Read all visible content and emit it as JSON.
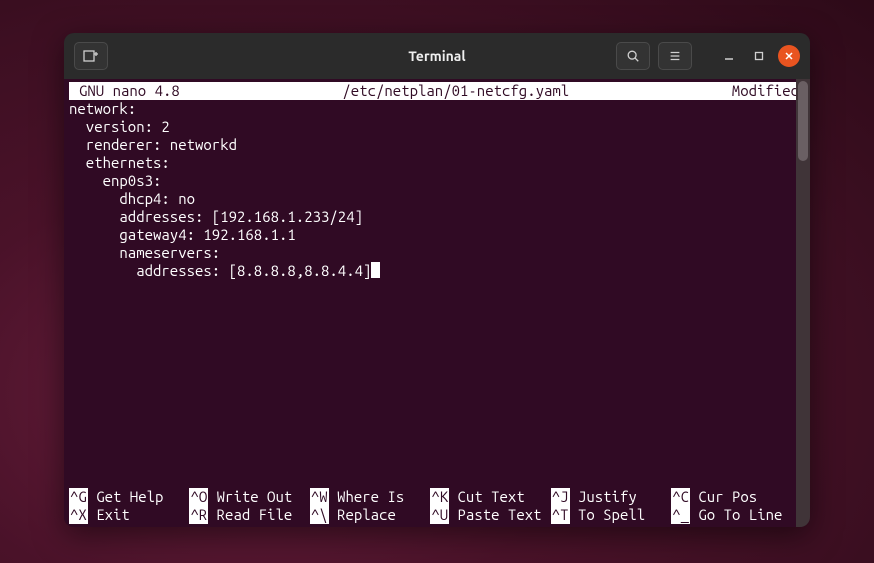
{
  "window": {
    "title": "Terminal"
  },
  "nano": {
    "header": {
      "version": "GNU nano 4.8",
      "filename": "/etc/netplan/01-netcfg.yaml",
      "status": "Modified"
    },
    "content": {
      "lines": [
        {
          "indent": 0,
          "text": "network:"
        },
        {
          "indent": 1,
          "text": "version: 2"
        },
        {
          "indent": 1,
          "text": "renderer: networkd"
        },
        {
          "indent": 1,
          "text": "ethernets:"
        },
        {
          "indent": 2,
          "text": "enp0s3:"
        },
        {
          "indent": 3,
          "text": "dhcp4: no"
        },
        {
          "indent": 3,
          "text": "addresses: [192.168.1.233/24]"
        },
        {
          "indent": 3,
          "text": "gateway4: 192.168.1.1"
        },
        {
          "indent": 3,
          "text": "nameservers:"
        },
        {
          "indent": 4,
          "text": "addresses: [8.8.8.8,8.8.4.4]",
          "cursor": true
        }
      ]
    },
    "footer": {
      "row1": [
        {
          "key": "^G",
          "label": "Get Help"
        },
        {
          "key": "^O",
          "label": "Write Out"
        },
        {
          "key": "^W",
          "label": "Where Is"
        },
        {
          "key": "^K",
          "label": "Cut Text"
        },
        {
          "key": "^J",
          "label": "Justify"
        },
        {
          "key": "^C",
          "label": "Cur Pos"
        }
      ],
      "row2": [
        {
          "key": "^X",
          "label": "Exit"
        },
        {
          "key": "^R",
          "label": "Read File"
        },
        {
          "key": "^\\",
          "label": "Replace"
        },
        {
          "key": "^U",
          "label": "Paste Text"
        },
        {
          "key": "^T",
          "label": "To Spell"
        },
        {
          "key": "^_",
          "label": "Go To Line"
        }
      ]
    }
  }
}
